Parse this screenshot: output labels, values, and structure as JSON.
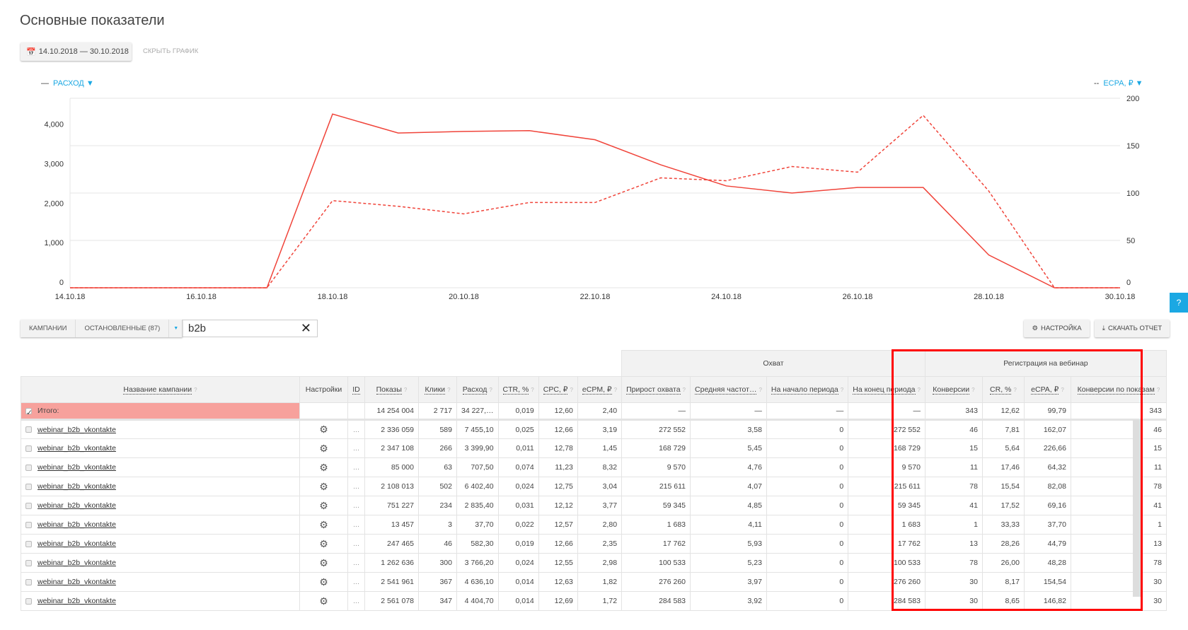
{
  "title": "Основные показатели",
  "date_range": "14.10.2018 — 30.10.2018",
  "hide_chart": "СКРЫТЬ ГРАФИК",
  "legend_left": {
    "marker": "—",
    "label": "РАСХОД ▼"
  },
  "legend_right": {
    "marker": "--",
    "label": "ECPA, ₽ ▼"
  },
  "help": "?",
  "chart_data": {
    "type": "line",
    "x": [
      "14.10.18",
      "15.10.18",
      "16.10.18",
      "17.10.18",
      "18.10.18",
      "19.10.18",
      "20.10.18",
      "21.10.18",
      "22.10.18",
      "23.10.18",
      "24.10.18",
      "25.10.18",
      "26.10.18",
      "27.10.18",
      "28.10.18",
      "29.10.18",
      "30.10.18"
    ],
    "xticks": [
      "14.10.18",
      "16.10.18",
      "18.10.18",
      "20.10.18",
      "22.10.18",
      "24.10.18",
      "26.10.18",
      "28.10.18",
      "30.10.18"
    ],
    "series": [
      {
        "name": "Расход",
        "axis": "left",
        "style": "solid",
        "color": "#f0443a",
        "values": [
          0,
          0,
          0,
          0,
          4400,
          3920,
          3960,
          3980,
          3750,
          3115,
          2580,
          2400,
          2540,
          2540,
          830,
          0,
          0
        ]
      },
      {
        "name": "ECPA, ₽",
        "axis": "right",
        "style": "dashed",
        "color": "#f0443a",
        "values": [
          0,
          0,
          0,
          0,
          92,
          86,
          78,
          90,
          90,
          116,
          113,
          128,
          122,
          182,
          102,
          0,
          0
        ]
      }
    ],
    "left_ticks": [
      "0",
      "1,000",
      "2,000",
      "3,000",
      "4,000"
    ],
    "left_ylim": [
      0,
      4800
    ],
    "right_ticks": [
      "0",
      "50",
      "100",
      "150",
      "200"
    ],
    "right_ylim": [
      0,
      200
    ],
    "grid": true
  },
  "toolbar": {
    "tab_campaigns": "КАМПАНИИ",
    "tab_stopped": "ОСТАНОВЛЕННЫЕ (87)",
    "dropdown": "▼",
    "search_value": "b2b",
    "clear": "✕",
    "settings": "НАСТРОЙКА",
    "download": "СКАЧАТЬ ОТЧЕТ"
  },
  "table": {
    "groups": {
      "reach": "Охват",
      "webinar": "Регистрация на вебинар"
    },
    "headers": [
      "Название кампании",
      "Настройки",
      "ID",
      "Показы",
      "Клики",
      "Расход",
      "CTR, %",
      "CPC, ₽",
      "eCPM, ₽",
      "Прирост охвата",
      "Средняя частот…",
      "На начало периода",
      "На конец периода",
      "Конверсии",
      "CR, %",
      "eCPA, ₽",
      "Конверсии по показам"
    ],
    "total": {
      "label": "Итого:",
      "values": [
        "14 254 004",
        "2 717",
        "34 227,…",
        "0,019",
        "12,60",
        "2,40",
        "—",
        "—",
        "—",
        "—",
        "343",
        "12,62",
        "99,79",
        "343"
      ]
    },
    "gear": "⚙",
    "dots": "...",
    "rows": [
      {
        "name": "webinar_b2b_vkontakte",
        "values": [
          "2 336 059",
          "589",
          "7 455,10",
          "0,025",
          "12,66",
          "3,19",
          "272 552",
          "3,58",
          "0",
          "272 552",
          "46",
          "7,81",
          "162,07",
          "46"
        ]
      },
      {
        "name": "webinar_b2b_vkontakte",
        "values": [
          "2 347 108",
          "266",
          "3 399,90",
          "0,011",
          "12,78",
          "1,45",
          "168 729",
          "5,45",
          "0",
          "168 729",
          "15",
          "5,64",
          "226,66",
          "15"
        ]
      },
      {
        "name": "webinar_b2b_vkontakte",
        "values": [
          "85 000",
          "63",
          "707,50",
          "0,074",
          "11,23",
          "8,32",
          "9 570",
          "4,76",
          "0",
          "9 570",
          "11",
          "17,46",
          "64,32",
          "11"
        ]
      },
      {
        "name": "webinar_b2b_vkontakte",
        "values": [
          "2 108 013",
          "502",
          "6 402,40",
          "0,024",
          "12,75",
          "3,04",
          "215 611",
          "4,07",
          "0",
          "215 611",
          "78",
          "15,54",
          "82,08",
          "78"
        ]
      },
      {
        "name": "webinar_b2b_vkontakte",
        "values": [
          "751 227",
          "234",
          "2 835,40",
          "0,031",
          "12,12",
          "3,77",
          "59 345",
          "4,85",
          "0",
          "59 345",
          "41",
          "17,52",
          "69,16",
          "41"
        ]
      },
      {
        "name": "webinar_b2b_vkontakte",
        "values": [
          "13 457",
          "3",
          "37,70",
          "0,022",
          "12,57",
          "2,80",
          "1 683",
          "4,11",
          "0",
          "1 683",
          "1",
          "33,33",
          "37,70",
          "1"
        ]
      },
      {
        "name": "webinar_b2b_vkontakte",
        "values": [
          "247 465",
          "46",
          "582,30",
          "0,019",
          "12,66",
          "2,35",
          "17 762",
          "5,93",
          "0",
          "17 762",
          "13",
          "28,26",
          "44,79",
          "13"
        ]
      },
      {
        "name": "webinar_b2b_vkontakte",
        "values": [
          "1 262 636",
          "300",
          "3 766,20",
          "0,024",
          "12,55",
          "2,98",
          "100 533",
          "5,23",
          "0",
          "100 533",
          "78",
          "26,00",
          "48,28",
          "78"
        ]
      },
      {
        "name": "webinar_b2b_vkontakte",
        "values": [
          "2 541 961",
          "367",
          "4 636,10",
          "0,014",
          "12,63",
          "1,82",
          "276 260",
          "3,97",
          "0",
          "276 260",
          "30",
          "8,17",
          "154,54",
          "30"
        ]
      },
      {
        "name": "webinar_b2b_vkontakte",
        "values": [
          "2 561 078",
          "347",
          "4 404,70",
          "0,014",
          "12,69",
          "1,72",
          "284 583",
          "3,92",
          "0",
          "284 583",
          "30",
          "8,65",
          "146,82",
          "30"
        ]
      }
    ]
  }
}
